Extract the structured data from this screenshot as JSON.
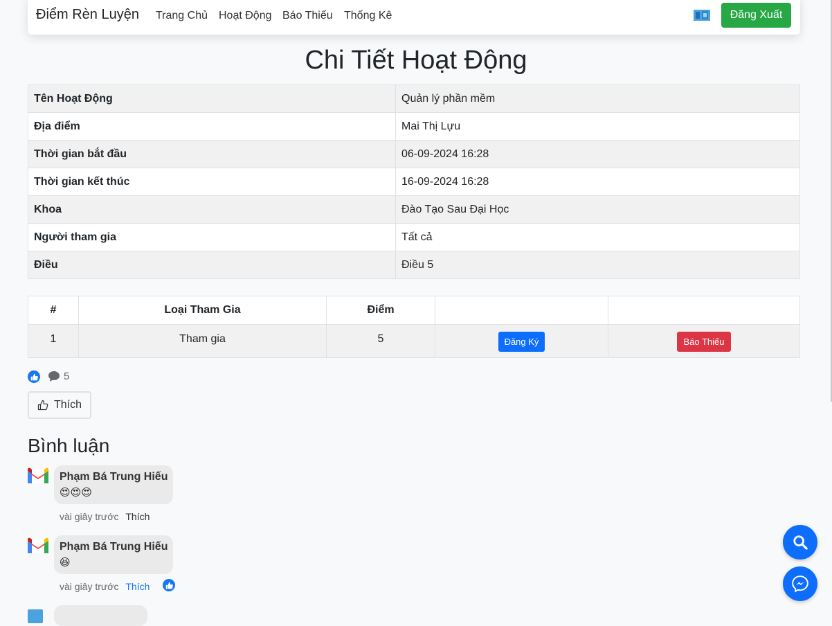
{
  "navbar": {
    "brand": "Điểm Rèn Luyện",
    "links": [
      "Trang Chủ",
      "Hoạt Động",
      "Báo Thiếu",
      "Thống Kê"
    ],
    "logout": "Đăng Xuất"
  },
  "page_title": "Chi Tiết Hoạt Động",
  "details": [
    {
      "label": "Tên Hoạt Động",
      "value": "Quản lý phần mềm"
    },
    {
      "label": "Địa điểm",
      "value": "Mai Thị Lựu"
    },
    {
      "label": "Thời gian bắt đầu",
      "value": "06-09-2024 16:28"
    },
    {
      "label": "Thời gian kết thúc",
      "value": "16-09-2024 16:28"
    },
    {
      "label": "Khoa",
      "value": "Đào Tạo Sau Đại Học"
    },
    {
      "label": "Người tham gia",
      "value": "Tất cả"
    },
    {
      "label": "Điều",
      "value": "Điều 5"
    }
  ],
  "types_table": {
    "headers": [
      "#",
      "Loại Tham Gia",
      "Điểm",
      "",
      ""
    ],
    "rows": [
      {
        "index": "1",
        "type": "Tham gia",
        "points": "5",
        "register": "Đăng Ký",
        "report": "Báo Thiếu"
      }
    ]
  },
  "reactions": {
    "comment_count": "5",
    "like_button": "Thích"
  },
  "comments_heading": "Bình luận",
  "comments": [
    {
      "author": "Phạm Bá Trung Hiếu",
      "content": "😍😍😍",
      "time": "vài giây trước",
      "like_label": "Thích",
      "liked": false
    },
    {
      "author": "Phạm Bá Trung Hiếu",
      "content": "😆",
      "time": "vài giây trước",
      "like_label": "Thích",
      "liked": true
    }
  ],
  "colors": {
    "primary": "#0d6efd",
    "success": "#28a745",
    "danger": "#dc3545",
    "facebook": "#1877f2"
  }
}
